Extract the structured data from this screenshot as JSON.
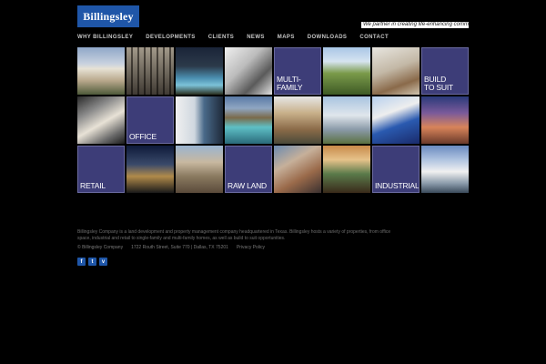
{
  "header": {
    "logo_text": "Billingsley",
    "tagline": "We partner in creating life-enhancing communities."
  },
  "nav": {
    "items": [
      "WHY BILLINGSLEY",
      "DEVELOPMENTS",
      "CLIENTS",
      "NEWS",
      "MAPS",
      "DOWNLOADS",
      "CONTACT"
    ]
  },
  "grid": {
    "categories": {
      "multifamily": "MULTI-\nFAMILY",
      "build_to_suit": "BUILD\nTO SUIT",
      "office": "OFFICE",
      "retail": "RETAIL",
      "raw_land": "RAW LAND",
      "industrial": "INDUSTRIAL"
    }
  },
  "footer": {
    "description": "Billingsley Company is a land development and property management company headquartered in Texas. Billingsley hosts a variety of properties, from office space, industrial and retail to single-family and multi-family homes, as well as build to suit opportunities.",
    "copyright": "© Billingsley Company",
    "address": "1722 Routh Street, Suite 770 | Dallas, TX 75201",
    "privacy": "Privacy Policy",
    "social": [
      "f",
      "t",
      "v"
    ]
  },
  "colors": {
    "category_tile": "#3d3d78",
    "brand_blue": "#1f56a8"
  }
}
